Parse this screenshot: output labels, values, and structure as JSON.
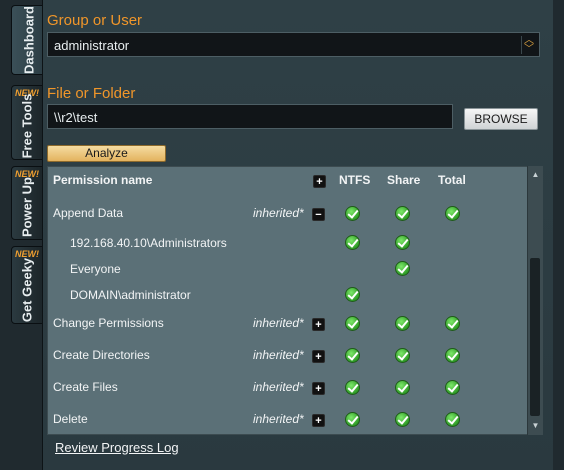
{
  "tabs": [
    {
      "label": "Dashboard",
      "new": ""
    },
    {
      "label": "Free Tools",
      "new": "NEW!"
    },
    {
      "label": "Power Up",
      "new": "NEW!"
    },
    {
      "label": "Get Geeky",
      "new": "NEW!"
    }
  ],
  "group_section": {
    "title": "Group or User",
    "value": "administrator"
  },
  "file_section": {
    "title": "File or Folder",
    "value": "\\\\r2\\test",
    "browse_label": "BROWSE"
  },
  "analyze_label": "Analyze",
  "table": {
    "headers": {
      "name": "Permission name",
      "toggle": "+",
      "ntfs": "NTFS",
      "share": "Share",
      "total": "Total"
    },
    "rows": [
      {
        "name": "Append Data",
        "inherited": "inherited*",
        "toggle": "−",
        "ntfs": true,
        "share": true,
        "total": true
      },
      {
        "name": "192.168.40.10\\Administrators",
        "inherited": "",
        "toggle": "",
        "ntfs": true,
        "share": true,
        "total": false
      },
      {
        "name": "Everyone",
        "inherited": "",
        "toggle": "",
        "ntfs": false,
        "share": true,
        "total": false
      },
      {
        "name": "DOMAIN\\administrator",
        "inherited": "",
        "toggle": "",
        "ntfs": true,
        "share": false,
        "total": false
      },
      {
        "name": "Change Permissions",
        "inherited": "inherited*",
        "toggle": "+",
        "ntfs": true,
        "share": true,
        "total": true
      },
      {
        "name": "Create Directories",
        "inherited": "inherited*",
        "toggle": "+",
        "ntfs": true,
        "share": true,
        "total": true
      },
      {
        "name": "Create Files",
        "inherited": "inherited*",
        "toggle": "+",
        "ntfs": true,
        "share": true,
        "total": true
      },
      {
        "name": "Delete",
        "inherited": "inherited*",
        "toggle": "+",
        "ntfs": true,
        "share": true,
        "total": true
      }
    ]
  },
  "review_log_label": "Review Progress Log",
  "colors": {
    "accent": "#f0962a",
    "check": "#3cb531",
    "panel": "#2f4046",
    "grid": "#5b7077"
  }
}
